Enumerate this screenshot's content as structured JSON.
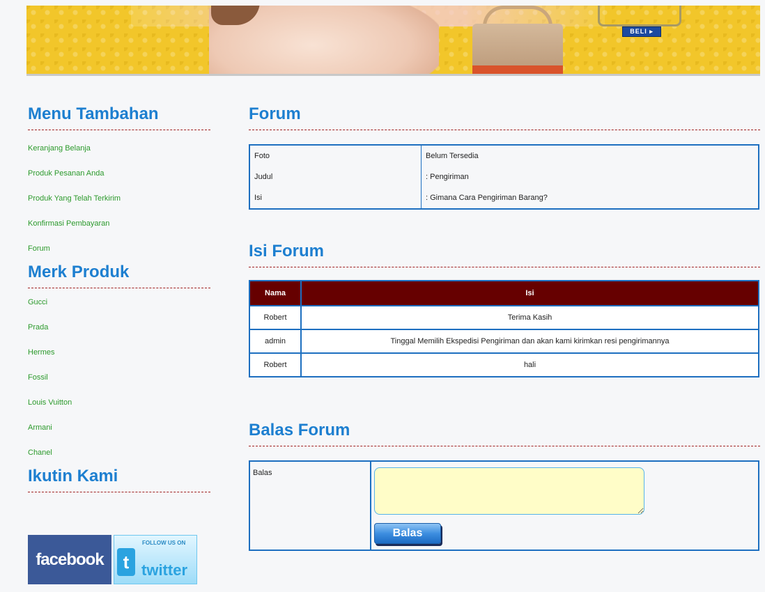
{
  "banner": {
    "buy_label": "BELI ▸"
  },
  "sidebar": {
    "menu_title": "Menu Tambahan",
    "menu_items": [
      {
        "label": "Keranjang Belanja"
      },
      {
        "label": "Produk Pesanan Anda"
      },
      {
        "label": "Produk Yang Telah Terkirim"
      },
      {
        "label": "Konfirmasi Pembayaran"
      },
      {
        "label": "Forum"
      }
    ],
    "brand_title": "Merk Produk",
    "brands": [
      {
        "label": "Gucci"
      },
      {
        "label": "Prada"
      },
      {
        "label": "Hermes"
      },
      {
        "label": "Fossil"
      },
      {
        "label": "Louis Vuitton"
      },
      {
        "label": "Armani"
      },
      {
        "label": "Chanel"
      }
    ],
    "follow_title": "Ikutin Kami",
    "social": {
      "facebook": "facebook",
      "twitter_follow": "FOLLOW US ON",
      "twitter": "twitter",
      "twitter_t": "t"
    }
  },
  "forum": {
    "title": "Forum",
    "rows": [
      {
        "key": "Foto",
        "value": "Belum Tersedia"
      },
      {
        "key": "Judul",
        "value": ": Pengiriman"
      },
      {
        "key": "Isi",
        "value": ": Gimana Cara Pengiriman Barang?"
      }
    ]
  },
  "isi_forum": {
    "title": "Isi Forum",
    "headers": [
      "Nama",
      "Isi"
    ],
    "rows": [
      {
        "nama": "Robert",
        "isi": "Terima Kasih"
      },
      {
        "nama": "admin",
        "isi": "Tinggal Memilih Ekspedisi Pengiriman dan akan kami kirimkan resi pengirimannya"
      },
      {
        "nama": "Robert",
        "isi": "hali"
      }
    ]
  },
  "reply": {
    "title": "Balas Forum",
    "label": "Balas",
    "textarea_value": "",
    "button_label": "Balas"
  },
  "colors": {
    "accent": "#1d7fd0",
    "link": "#2c9a2c",
    "table_header": "#660000",
    "border": "#1d6fc0",
    "banner": "#f2c62a"
  }
}
